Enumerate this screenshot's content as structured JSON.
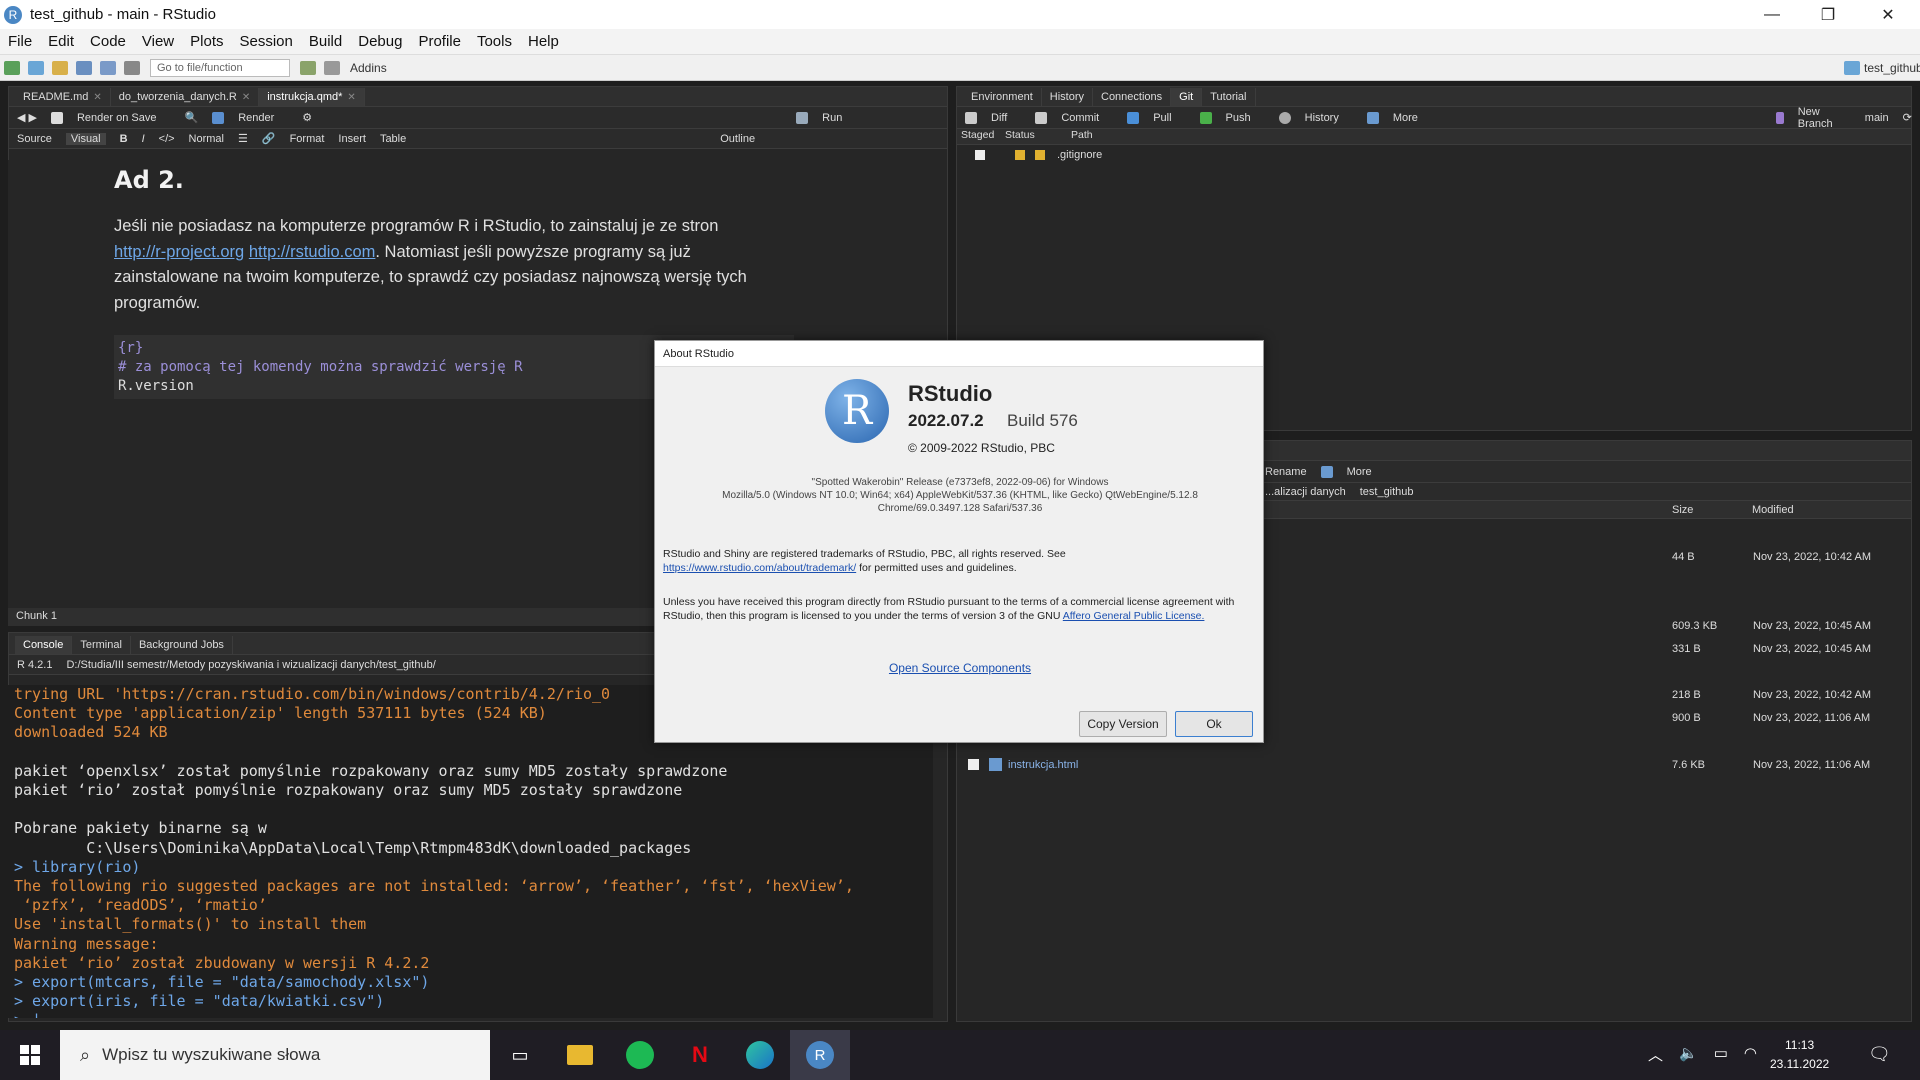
{
  "window": {
    "title": "test_github - main - RStudio",
    "app_icon": "R"
  },
  "menu": [
    "File",
    "Edit",
    "Code",
    "View",
    "Plots",
    "Session",
    "Build",
    "Debug",
    "Profile",
    "Tools",
    "Help"
  ],
  "toolbar": {
    "goto_placeholder": "Go to file/function",
    "addins": "Addins",
    "project": "test_github"
  },
  "editor": {
    "tabs": [
      "README.md",
      "do_tworzenia_danych.R",
      "instrukcja.qmd*"
    ],
    "toolbar": {
      "render_on_save": "Render on Save",
      "render": "Render",
      "run": "Run"
    },
    "format_bar": {
      "source": "Source",
      "visual": "Visual",
      "normal": "Normal",
      "format": "Format",
      "insert": "Insert",
      "table": "Table",
      "outline": "Outline"
    },
    "heading": "Ad 2.",
    "para_1": "Jeśli nie posiadasz na komputerze programów R i RStudio, to zainstaluj je ze stron",
    "link_1": "http://r-project.org",
    "link_2": "http://rstudio.com",
    "para_2": ". Natomiast jeśli powyższe programy są już zainstalowane na twoim komputerze, to sprawdź czy posiadasz najnowszą wersję tych programów.",
    "code_lines": [
      "{r}",
      "# za pomocą tej komendy można sprawdzić wersję R",
      "R.version"
    ],
    "chunk_label": "Chunk 1"
  },
  "console": {
    "tabs": [
      "Console",
      "Terminal",
      "Background Jobs"
    ],
    "r_version": "R 4.2.1",
    "path": "D:/Studia/III semestr/Metody pozyskiwania i wizualizacji danych/test_github/",
    "lines": [
      {
        "t": "warn",
        "s": "trying URL 'https://cran.rstudio.com/bin/windows/contrib/4.2/rio_0"
      },
      {
        "t": "warn",
        "s": "Content type 'application/zip' length 537111 bytes (524 KB)"
      },
      {
        "t": "warn",
        "s": "downloaded 524 KB"
      },
      {
        "t": "out",
        "s": ""
      },
      {
        "t": "out",
        "s": "pakiet ‘openxlsx’ został pomyślnie rozpakowany oraz sumy MD5 zostały sprawdzone"
      },
      {
        "t": "out",
        "s": "pakiet ‘rio’ został pomyślnie rozpakowany oraz sumy MD5 zostały sprawdzone"
      },
      {
        "t": "out",
        "s": ""
      },
      {
        "t": "out",
        "s": "Pobrane pakiety binarne są w"
      },
      {
        "t": "out",
        "s": "        C:\\Users\\Dominika\\AppData\\Local\\Temp\\Rtmpm483dK\\downloaded_packages"
      },
      {
        "t": "cmd",
        "s": "> library(rio)"
      },
      {
        "t": "warn",
        "s": "The following rio suggested packages are not installed: ‘arrow’, ‘feather’, ‘fst’, ‘hexView’,"
      },
      {
        "t": "warn",
        "s": " ‘pzfx’, ‘readODS’, ‘rmatio’"
      },
      {
        "t": "warn",
        "s": "Use 'install_formats()' to install them"
      },
      {
        "t": "warn",
        "s": "Warning message:"
      },
      {
        "t": "warn",
        "s": "pakiet ‘rio’ został zbudowany w wersji R 4.2.2"
      },
      {
        "t": "cmd",
        "s": "> export(mtcars, file = \"data/samochody.xlsx\")"
      },
      {
        "t": "cmd",
        "s": "> export(iris, file = \"data/kwiatki.csv\")"
      },
      {
        "t": "cmd",
        "s": "> |"
      }
    ]
  },
  "env_pane": {
    "tabs": [
      "Environment",
      "History",
      "Connections",
      "Git",
      "Tutorial"
    ],
    "git_toolbar": {
      "diff": "Diff",
      "commit": "Commit",
      "pull": "Pull",
      "push": "Push",
      "history": "History",
      "more": "More",
      "new_branch": "New Branch",
      "branch": "main"
    },
    "columns": [
      "Staged",
      "Status",
      "Path"
    ],
    "files": [
      ".gitignore"
    ]
  },
  "files_pane": {
    "toolbar": {
      "rename": "Rename",
      "more": "More"
    },
    "breadcrumb": [
      "...alizacji danych",
      "test_github"
    ],
    "columns": [
      "Size",
      "Modified"
    ],
    "rows": [
      {
        "size": "44 B",
        "modified": "Nov 23, 2022, 10:42 AM"
      },
      {
        "size": "609.3 KB",
        "modified": "Nov 23, 2022, 10:45 AM"
      },
      {
        "size": "331 B",
        "modified": "Nov 23, 2022, 10:45 AM"
      },
      {
        "size": "218 B",
        "modified": "Nov 23, 2022, 10:42 AM"
      },
      {
        "size": "900 B",
        "modified": "Nov 23, 2022, 11:06 AM"
      },
      {
        "name": "instrukcja.html",
        "size": "7.6 KB",
        "modified": "Nov 23, 2022, 11:06 AM"
      }
    ]
  },
  "about": {
    "title": "About RStudio",
    "logo": "R",
    "product": "RStudio",
    "version": "2022.07.2",
    "build": "Build 576",
    "copyright": "© 2009-2022 RStudio, PBC",
    "release": "\"Spotted Wakerobin\" Release (e7373ef8, 2022-09-06) for Windows",
    "ua1": "Mozilla/5.0 (Windows NT 10.0; Win64; x64) AppleWebKit/537.36 (KHTML, like Gecko) QtWebEngine/5.12.8",
    "ua2": "Chrome/69.0.3497.128 Safari/537.36",
    "tm1": "RStudio and Shiny are registered trademarks of RStudio, PBC, all rights reserved. See",
    "tm_link": "https://www.rstudio.com/about/trademark/",
    "tm2": " for permitted uses and guidelines.",
    "lic": "Unless you have received this program directly from RStudio pursuant to the terms of a commercial license agreement with RStudio, then this program is licensed to you under the terms of version 3 of the GNU ",
    "lic_link": "Affero General Public License.",
    "oss": "Open Source Components",
    "copy_btn": "Copy Version",
    "ok_btn": "Ok"
  },
  "taskbar": {
    "search_placeholder": "Wpisz tu wyszukiwane słowa",
    "time": "11:13",
    "date": "23.11.2022",
    "rstudio_letter": "R",
    "netflix_letter": "N"
  },
  "colors": {
    "accent": "#4a87c4",
    "warn": "#e08a3c",
    "cmd": "#6ea7e8"
  }
}
